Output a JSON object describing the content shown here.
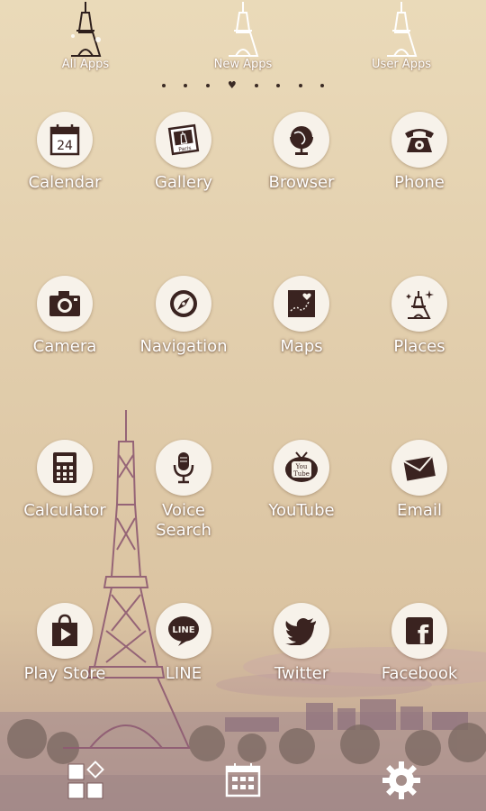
{
  "tabs": [
    {
      "label": "All Apps"
    },
    {
      "label": "New Apps"
    },
    {
      "label": "User Apps"
    }
  ],
  "page_indicator": {
    "dots_before": 3,
    "dots_after": 4,
    "current": "heart"
  },
  "apps": [
    {
      "label": "Calendar",
      "icon": "calendar-icon",
      "date": "24"
    },
    {
      "label": "Gallery",
      "icon": "gallery-icon",
      "caption": "Paris"
    },
    {
      "label": "Browser",
      "icon": "globe-icon"
    },
    {
      "label": "Phone",
      "icon": "phone-icon"
    },
    {
      "label": "Camera",
      "icon": "camera-icon"
    },
    {
      "label": "Navigation",
      "icon": "compass-icon"
    },
    {
      "label": "Maps",
      "icon": "map-icon"
    },
    {
      "label": "Places",
      "icon": "eiffel-sparkle-icon"
    },
    {
      "label": "Calculator",
      "icon": "calculator-icon"
    },
    {
      "label": "Voice Search",
      "label_lines": [
        "Voice",
        "Search"
      ],
      "icon": "microphone-icon"
    },
    {
      "label": "YouTube",
      "icon": "tv-icon",
      "screen_text": [
        "You",
        "Tube"
      ]
    },
    {
      "label": "Email",
      "icon": "envelope-icon"
    },
    {
      "label": "Play Store",
      "icon": "play-bag-icon"
    },
    {
      "label": "LINE",
      "icon": "line-bubble-icon",
      "bubble_text": "LINE"
    },
    {
      "label": "Twitter",
      "icon": "bird-icon"
    },
    {
      "label": "Facebook",
      "icon": "facebook-icon",
      "glyph": "f"
    }
  ],
  "dock": [
    {
      "icon": "widgets-icon"
    },
    {
      "icon": "app-drawer-icon"
    },
    {
      "icon": "settings-gear-icon"
    }
  ],
  "colors": {
    "accent": "#4a2a24",
    "badge": "#f7f2ea",
    "label": "#ffffff"
  }
}
